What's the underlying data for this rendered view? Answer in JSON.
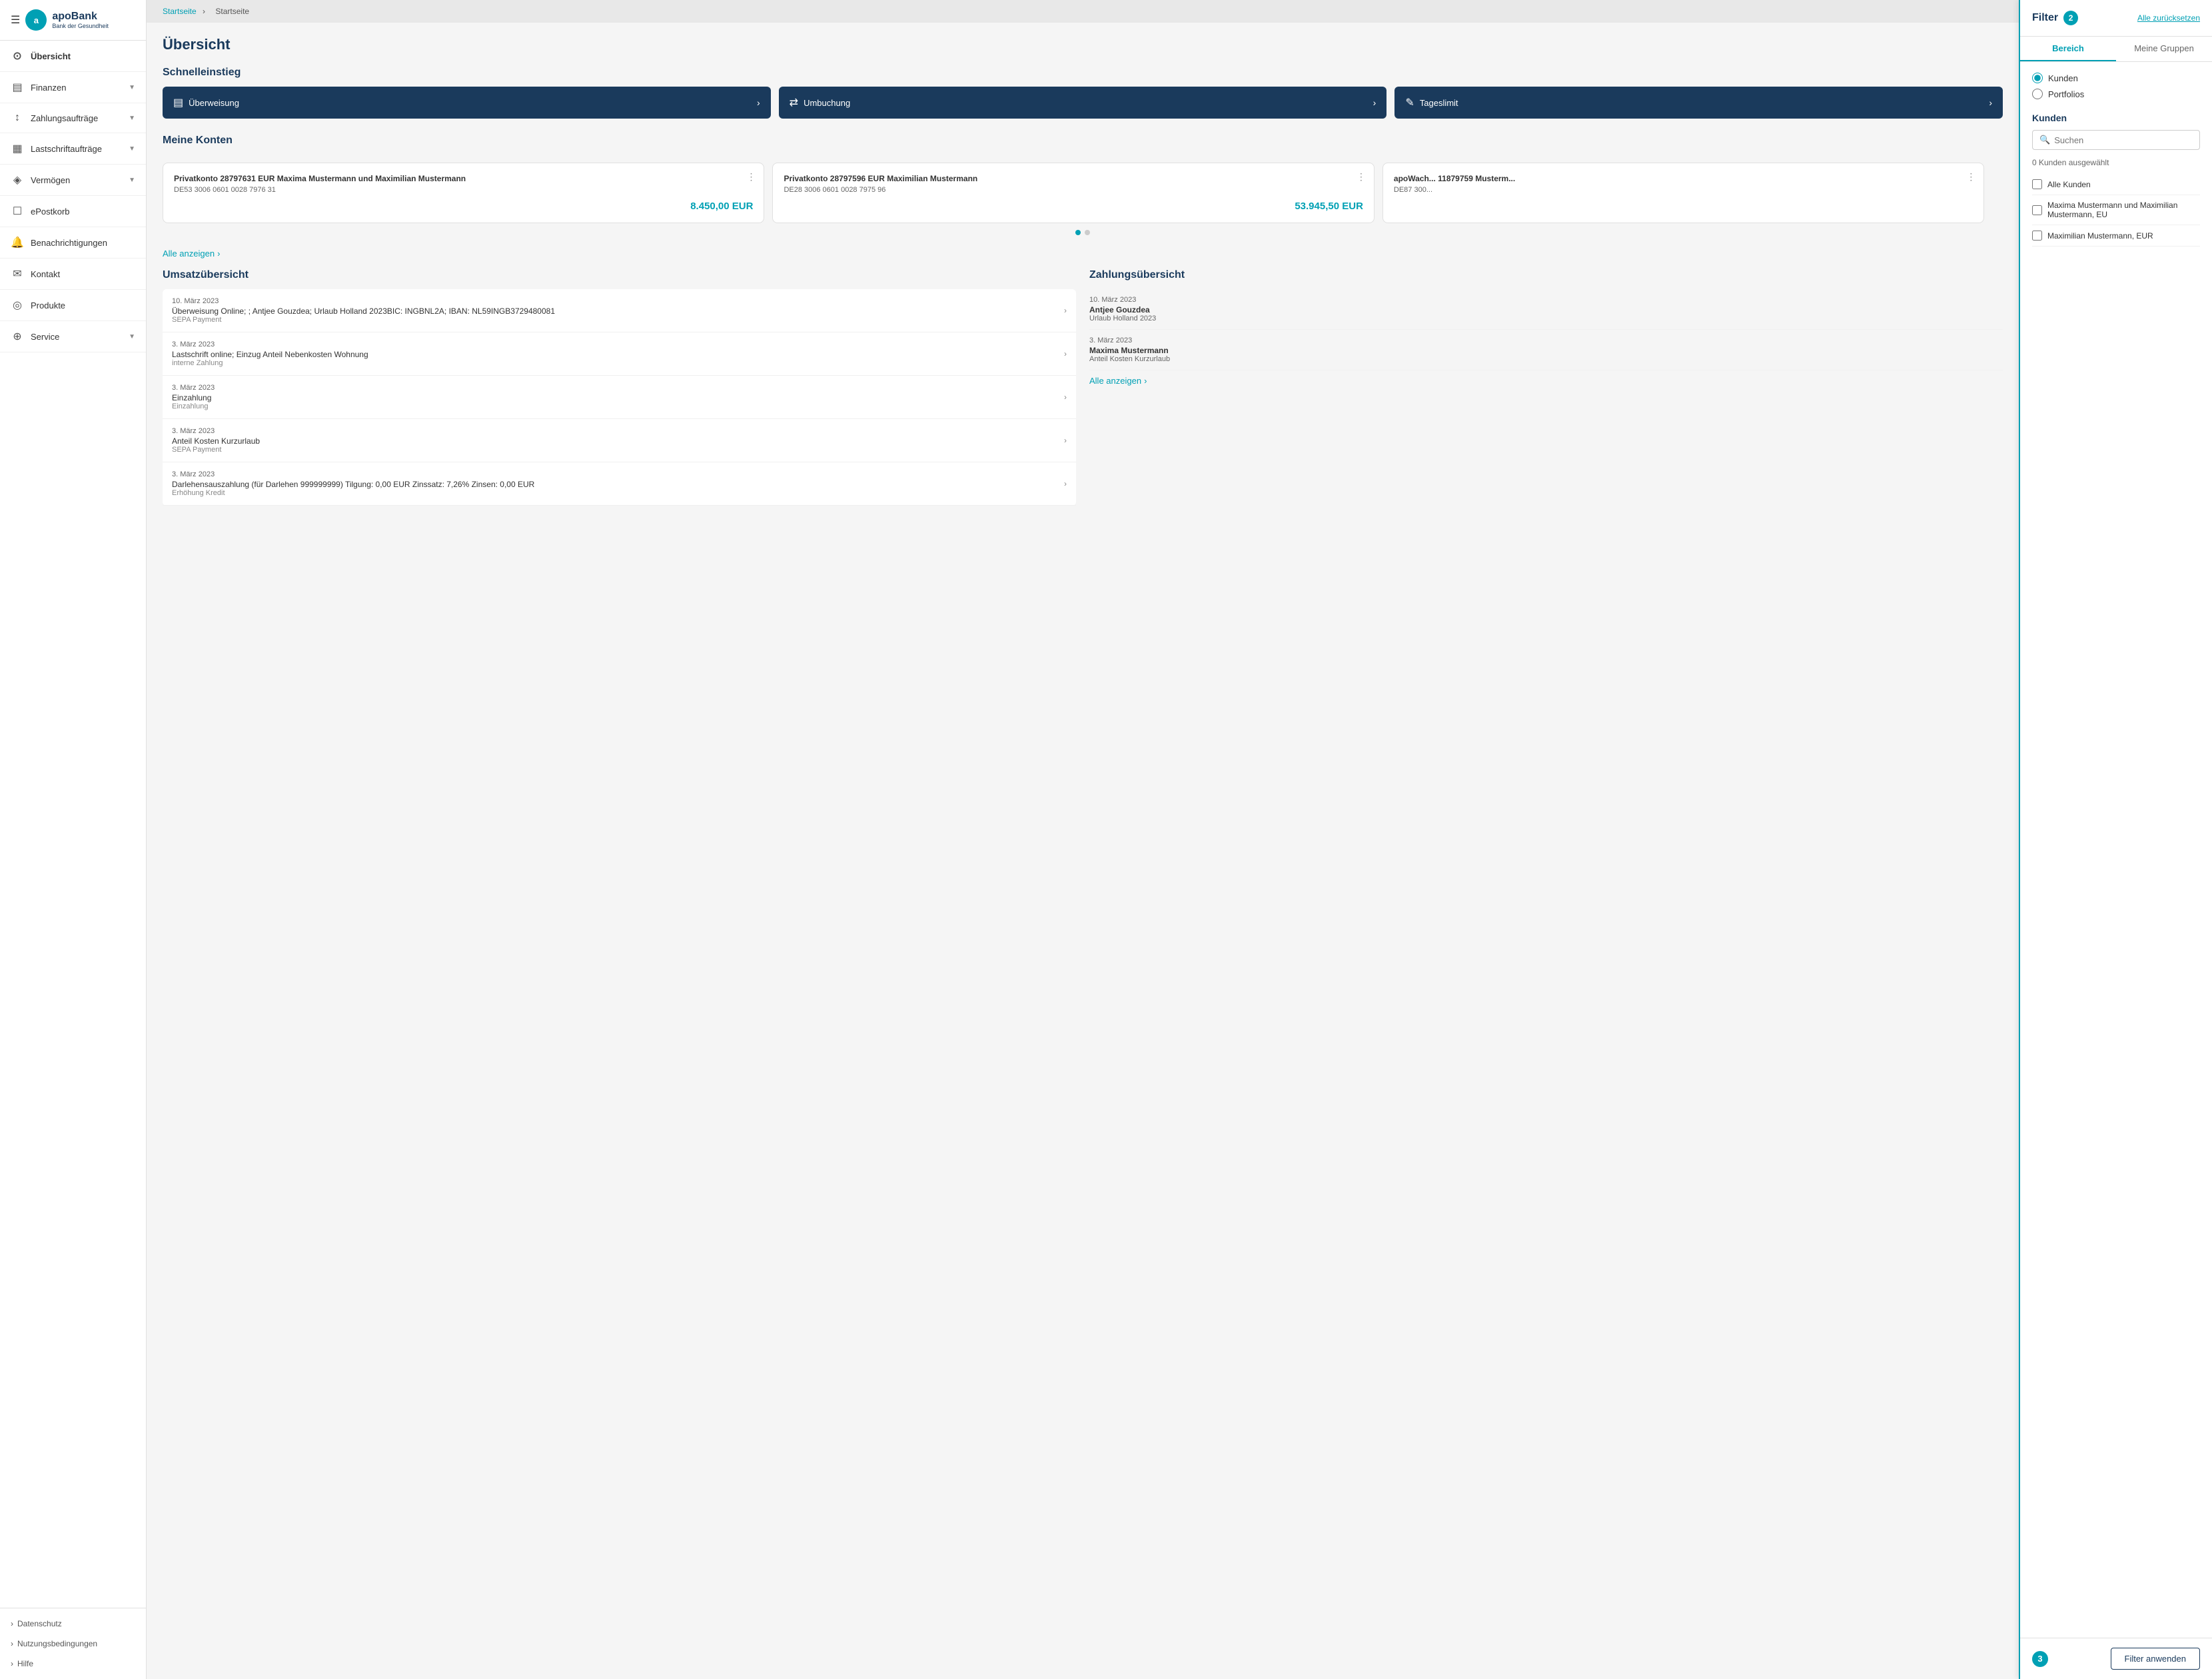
{
  "sidebar": {
    "logo_text": "apoBank",
    "logo_sub": "Bank der Gesundheit",
    "logo_letter": "a",
    "nav_items": [
      {
        "id": "uebersicht",
        "label": "Übersicht",
        "icon": "⊙",
        "active": true,
        "has_chevron": false
      },
      {
        "id": "finanzen",
        "label": "Finanzen",
        "icon": "▤",
        "active": false,
        "has_chevron": true
      },
      {
        "id": "zahlungsauftraege",
        "label": "Zahlungsaufträge",
        "icon": "↕",
        "active": false,
        "has_chevron": true
      },
      {
        "id": "lastschriftauftraege",
        "label": "Lastschriftaufträge",
        "icon": "▦",
        "active": false,
        "has_chevron": true
      },
      {
        "id": "vermoegen",
        "label": "Vermögen",
        "icon": "◈",
        "active": false,
        "has_chevron": true
      },
      {
        "id": "epostkorb",
        "label": "ePostkorb",
        "icon": "☐",
        "active": false,
        "has_chevron": false
      },
      {
        "id": "benachrichtigungen",
        "label": "Benachrichtigungen",
        "icon": "🔔",
        "active": false,
        "has_chevron": false
      },
      {
        "id": "kontakt",
        "label": "Kontakt",
        "icon": "✉",
        "active": false,
        "has_chevron": false
      },
      {
        "id": "produkte",
        "label": "Produkte",
        "icon": "◎",
        "active": false,
        "has_chevron": false
      },
      {
        "id": "service",
        "label": "Service",
        "icon": "⊕",
        "active": false,
        "has_chevron": true
      }
    ],
    "footer_items": [
      {
        "id": "datenschutz",
        "label": "Datenschutz"
      },
      {
        "id": "nutzungsbedingungen",
        "label": "Nutzungsbedingungen"
      },
      {
        "id": "hilfe",
        "label": "Hilfe"
      }
    ]
  },
  "breadcrumb": {
    "home": "Startseite",
    "separator": "›",
    "current": "Startseite"
  },
  "page": {
    "title": "Übersicht"
  },
  "schnelleinstieg": {
    "title": "Schnelleinstieg",
    "buttons": [
      {
        "id": "ueberweisung",
        "label": "Überweisung",
        "icon": "▤"
      },
      {
        "id": "umbuchung",
        "label": "Umbuchung",
        "icon": "⇄"
      },
      {
        "id": "tageslimit",
        "label": "Tageslimit",
        "icon": "✎"
      }
    ]
  },
  "meine_konten": {
    "title": "Meine Konten",
    "alle_anzeigen": "Alle anzeigen",
    "konten": [
      {
        "title": "Privatkonto 28797631 EUR Maxima Mustermann und Maximilian Mustermann",
        "iban": "DE53 3006 0601 0028 7976 31",
        "amount": "8.450,00 EUR"
      },
      {
        "title": "Privatkonto 28797596 EUR Maximilian Mustermann",
        "iban": "DE28 3006 0601 0028 7975 96",
        "amount": "53.945,50 EUR"
      },
      {
        "title": "apoWach... 11879759 Musterm...",
        "iban": "DE87 300...",
        "amount": ""
      }
    ]
  },
  "umsatzuebersicht": {
    "title": "Umsatzübersicht",
    "items": [
      {
        "date": "10. März 2023",
        "desc": "Überweisung Online; ; Antjee Gouzdea; Urlaub Holland 2023BIC: INGBNL2A; IBAN: NL59INGB3729480081",
        "sub": "SEPA Payment"
      },
      {
        "date": "3. März 2023",
        "desc": "Lastschrift online; Einzug Anteil Nebenkosten Wohnung",
        "sub": "interne Zahlung"
      },
      {
        "date": "3. März 2023",
        "desc": "Einzahlung",
        "sub": "Einzahlung"
      },
      {
        "date": "3. März 2023",
        "desc": "Anteil Kosten Kurzurlaub",
        "sub": "SEPA Payment"
      },
      {
        "date": "3. März 2023",
        "desc": "Darlehensauszahlung (für Darlehen 999999999) Tilgung: 0,00 EUR Zinssatz: 7,26% Zinsen: 0,00 EUR",
        "sub": "Erhöhung Kredit"
      }
    ]
  },
  "zahlungsuebersicht": {
    "title": "Zahlungsübersicht",
    "alle_anzeigen": "Alle anzeigen",
    "items": [
      {
        "date": "10. März 2023",
        "name": "Antjee Gouzdea",
        "desc": "Urlaub Holland 2023"
      },
      {
        "date": "3. März 2023",
        "name": "Maxima Mustermann",
        "desc": "Anteil Kosten Kurzurlaub"
      }
    ]
  },
  "filter": {
    "title": "Filter",
    "reset_label": "Alle zurücksetzen",
    "badge_count": "2",
    "tabs": [
      {
        "id": "bereich",
        "label": "Bereich",
        "active": true
      },
      {
        "id": "meine_gruppen",
        "label": "Meine Gruppen",
        "active": false
      }
    ],
    "radio_options": [
      {
        "id": "kunden",
        "label": "Kunden",
        "checked": true
      },
      {
        "id": "portfolios",
        "label": "Portfolios",
        "checked": false
      }
    ],
    "kunden_section": {
      "title": "Kunden",
      "search_placeholder": "Suchen",
      "count_label": "0 Kunden ausgewählt",
      "checkboxes": [
        {
          "id": "alle_kunden",
          "label": "Alle Kunden",
          "checked": false
        },
        {
          "id": "maxima_maximilian",
          "label": "Maxima Mustermann und Maximilian Mustermann, EU",
          "checked": false
        },
        {
          "id": "maximilian",
          "label": "Maximilian Mustermann, EUR",
          "checked": false
        }
      ]
    },
    "footer": {
      "step_badge": "3",
      "apply_label": "Filter anwenden"
    }
  }
}
